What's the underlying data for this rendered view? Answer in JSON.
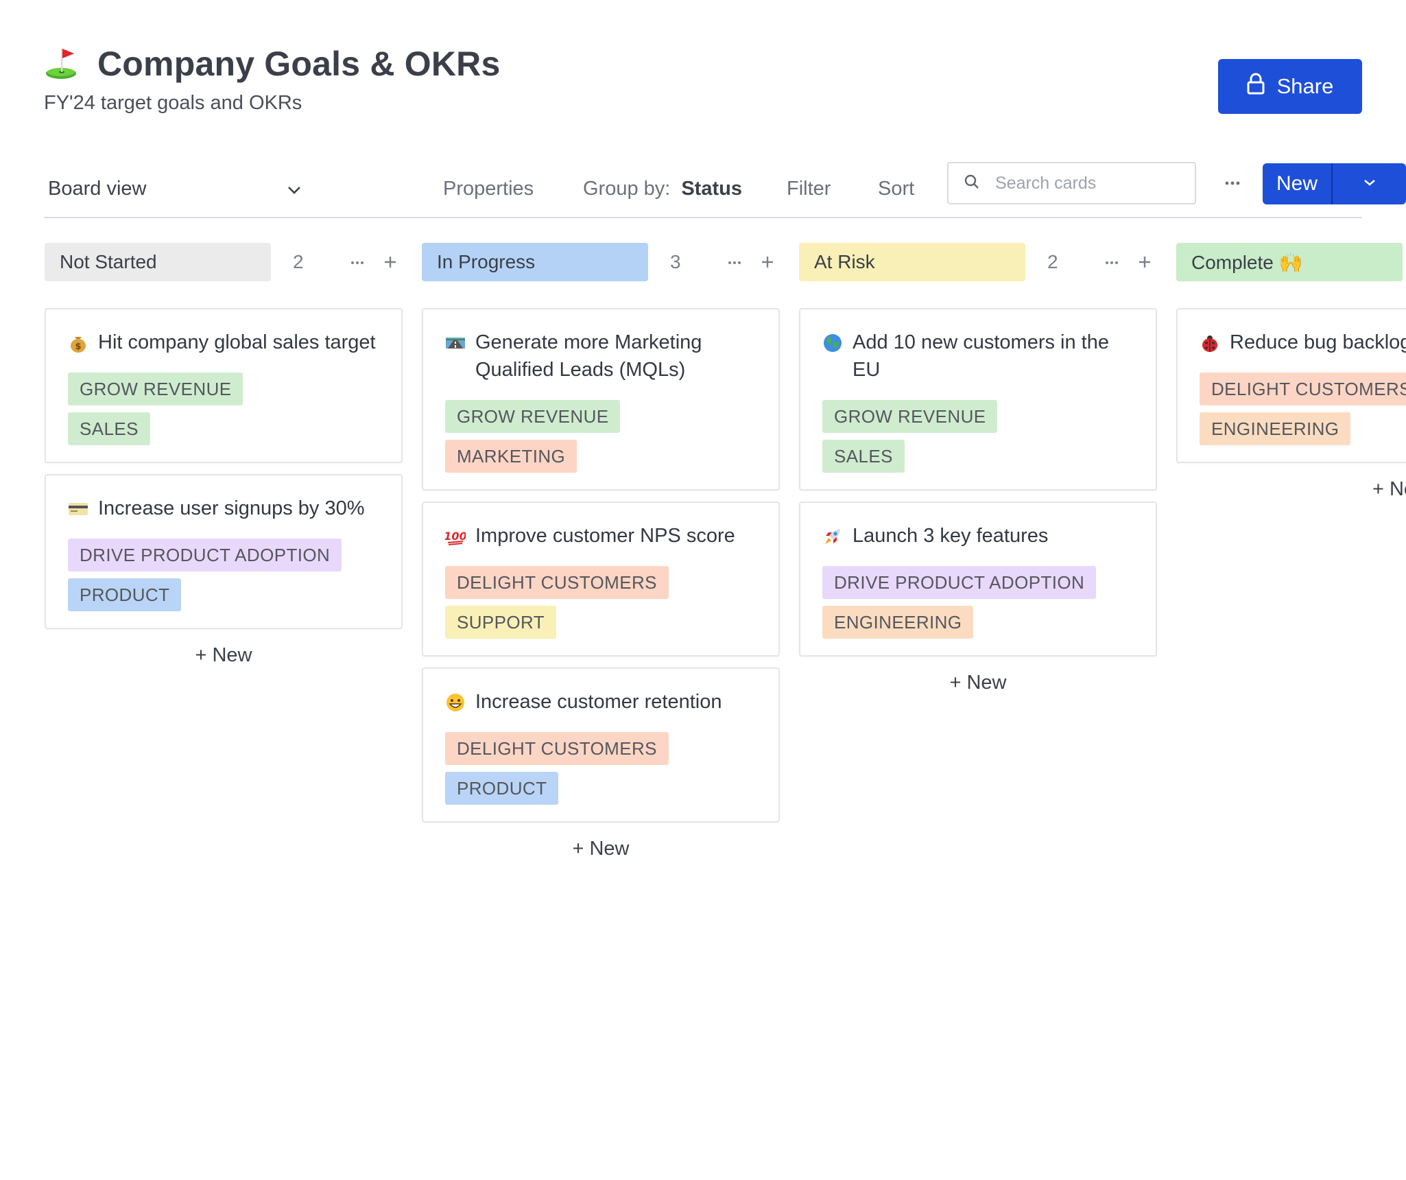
{
  "header": {
    "title": "Company Goals & OKRs",
    "subtitle": "FY'24 target goals and OKRs",
    "title_icon": "golf-flag-icon",
    "share_label": "Share"
  },
  "toolbar": {
    "view_label": "Board view",
    "properties_label": "Properties",
    "group_by_label": "Group by:",
    "group_by_value": "Status",
    "filter_label": "Filter",
    "sort_label": "Sort",
    "search_placeholder": "Search cards",
    "new_label": "New"
  },
  "colors": {
    "accent": "#1e4fd8",
    "not_started": "#ebebeb",
    "in_progress": "#b4d2f5",
    "at_risk": "#f8f0b6",
    "complete": "#c9ecc9"
  },
  "columns": [
    {
      "label": "Not Started",
      "count": "2",
      "add_label": "+ New",
      "cards": [
        {
          "icon": "money-bag-icon",
          "title": "Hit company global sales target",
          "tags": [
            "GROW REVENUE",
            "SALES"
          ]
        },
        {
          "icon": "credit-card-icon",
          "title": "Increase user signups by 30%",
          "tags": [
            "DRIVE PRODUCT ADOPTION",
            "PRODUCT"
          ]
        }
      ]
    },
    {
      "label": "In Progress",
      "count": "3",
      "add_label": "+ New",
      "cards": [
        {
          "icon": "motorway-icon",
          "title": "Generate more Marketing Qualified Leads (MQLs)",
          "tags": [
            "GROW REVENUE",
            "MARKETING"
          ]
        },
        {
          "icon": "hundred-points-icon",
          "title": "Improve customer NPS score",
          "tags": [
            "DELIGHT CUSTOMERS",
            "SUPPORT"
          ]
        },
        {
          "icon": "grinning-face-icon",
          "title": "Increase customer retention",
          "tags": [
            "DELIGHT CUSTOMERS",
            "PRODUCT"
          ]
        }
      ]
    },
    {
      "label": "At Risk",
      "count": "2",
      "add_label": "+ New",
      "cards": [
        {
          "icon": "globe-icon",
          "title": "Add 10 new customers in the EU",
          "tags": [
            "GROW REVENUE",
            "SALES"
          ]
        },
        {
          "icon": "rocket-icon",
          "title": "Launch 3 key features",
          "tags": [
            "DRIVE PRODUCT ADOPTION",
            "ENGINEERING"
          ]
        }
      ]
    },
    {
      "label": "Complete 🙌",
      "count": "",
      "add_label": "+ New",
      "cards": [
        {
          "icon": "ladybug-icon",
          "title": "Reduce bug backlog",
          "tags": [
            "DELIGHT CUSTOMERS",
            "ENGINEERING"
          ]
        }
      ]
    }
  ]
}
